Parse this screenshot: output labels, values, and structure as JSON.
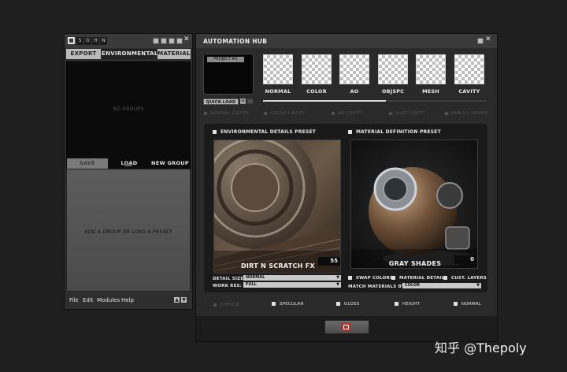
{
  "left_panel": {
    "toolbar_letters": [
      "S",
      "G",
      "H",
      "N"
    ],
    "tabs": [
      {
        "label": "EXPORT",
        "active": false
      },
      {
        "label": "ENVIRONMENTAL",
        "active": true
      },
      {
        "label": "MATERIAL",
        "active": false
      }
    ],
    "list_empty_text": "NO GROUPS",
    "buttons": {
      "save": "SAVE PRESET...",
      "load": "LOAD PRESET...",
      "new": "NEW GROUP"
    },
    "drop_hint": "ADD A GROUP OR LOAD A PRESET",
    "menu": [
      "File",
      "Edit",
      "Modules",
      "Help"
    ]
  },
  "hub": {
    "title": "AUTOMATION HUB",
    "project_label": "PROJECT #1",
    "maps": [
      "NORMAL",
      "COLOR",
      "AO",
      "OBJSPC",
      "MESH",
      "CAVITY"
    ],
    "quick_load_label": "QUICK-LOAD",
    "slider_fraction": 0.55,
    "map_options": [
      "NORMAL CAVITY",
      "COLOR CAVITY",
      "AO CAVITY",
      "SLOT CAVITY",
      "HDB UV SEAMS"
    ],
    "env_preset_label": "ENVIRONMENTAL DETAILS PRESET",
    "mat_preset_label": "MATERIAL DEFINITION PRESET",
    "env_preview": {
      "name": "DIRT N SCRATCH FX",
      "value": "55"
    },
    "mat_preview": {
      "name": "GRAY SHADES",
      "value": "0"
    },
    "detail_size_label": "DETAIL SIZE:",
    "detail_size_value": "NORMAL",
    "work_res_label": "WORK RES:",
    "work_res_value": "FULL",
    "swap_colors": "SWAP COLORS",
    "material_details": "MATERIAL DETAILS",
    "cust_layers": "CUST. LAYERS",
    "match_by_label": "MATCH MATERIALS BY:",
    "match_by_value": "COLOR",
    "bottom_options": [
      "DIFFUSE",
      "SPECULAR",
      "GLOSS",
      "HEIGHT",
      "NORMAL"
    ]
  },
  "watermark": "知乎 @Thepoly"
}
